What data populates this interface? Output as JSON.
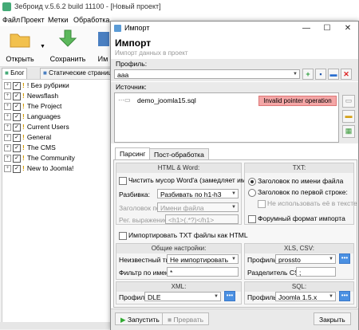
{
  "app": {
    "title": "Зеброид v.5.6.2 build 11100 - [Новый проект]",
    "menu": [
      "Файл",
      "Проект",
      "Метки",
      "Обработка"
    ],
    "toolbar": {
      "open": "Открыть",
      "save": "Сохранить",
      "import_partial": "Им"
    },
    "tabs": [
      "Блог",
      "Статические страниц"
    ],
    "tree": [
      {
        "label": "! Без рубрики"
      },
      {
        "label": "Newsflash"
      },
      {
        "label": "The Project"
      },
      {
        "label": "Languages"
      },
      {
        "label": "Current Users"
      },
      {
        "label": "General"
      },
      {
        "label": "The CMS"
      },
      {
        "label": "The Community"
      },
      {
        "label": "New to Joomla!"
      }
    ]
  },
  "dialog": {
    "title": "Импорт",
    "heading": "Импорт",
    "subheading": "Импорт данных в проект",
    "profile_label": "Профиль:",
    "profile_value": "aaa",
    "sources_label": "Источник:",
    "source_file": "demo_joomla15.sql",
    "source_error": "Invalid pointer operation",
    "tabs": [
      "Парсинг",
      "Пост-обработка"
    ],
    "html_word": {
      "title": "HTML & Word:",
      "clean_word": "Чистить мусор Word'а (замедляет импорт)",
      "split_label": "Разбивка:",
      "split_value": "Разбивать по h1-h3",
      "title_label": "Заголовок по:",
      "title_value": "Имени файла",
      "regex_label": "Рег. выражение:",
      "regex_value": "<h1>(.*?)</h1>"
    },
    "txt": {
      "title": "TXT:",
      "opt_filename": "Заголовок по имени файла",
      "opt_first_line": "Заголовок по первой строке:",
      "no_use_text": "Не использовать её в тексте",
      "forum_format": "Форумный формат импорта"
    },
    "import_txt_html": "Импортировать TXT файлы как HTML",
    "general": {
      "title": "Общие настройки:",
      "unknown_type_label": "Неизвестный тип:",
      "unknown_type_value": "Не импортировать",
      "filename_filter_label": "Фильтр по имени:",
      "filename_filter_value": "*"
    },
    "xls_csv": {
      "title": "XLS, CSV:",
      "profile_label": "Профиль:",
      "profile_value": "prossto",
      "separator_label": "Разделитель CSV:",
      "separator_value": ";"
    },
    "xml": {
      "title": "XML:",
      "profile_label": "Профиль:",
      "profile_value": "DLE"
    },
    "sql": {
      "title": "SQL:",
      "profile_label": "Профиль:",
      "profile_value": "Joomla 1.5.x"
    },
    "buttons": {
      "start": "Запустить",
      "abort": "Прервать",
      "close": "Закрыть"
    }
  },
  "colors": {
    "error_bg": "#f4a6a6",
    "accent": "#4a90e2"
  }
}
